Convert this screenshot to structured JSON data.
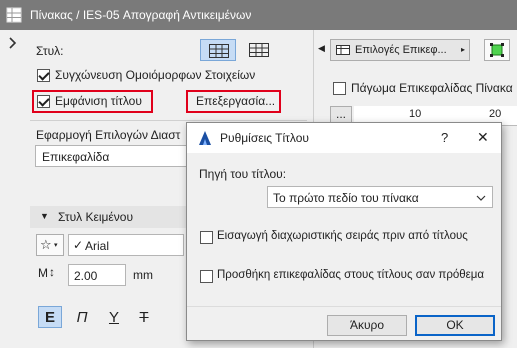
{
  "window": {
    "title": "Πίνακας / IES-05 Απογραφή Αντικειμένων"
  },
  "left": {
    "style_label": "Στυλ:",
    "merge_label": "Συγχώνευση Ομοιόμορφων Στοιχείων",
    "merge_checked": true,
    "show_title_label": "Εμφάνιση τίτλου",
    "show_title_checked": true,
    "edit_button": "Επεξεργασία...",
    "apply_options_label": "Εφαρμογή Επιλογών Διαστ",
    "apply_select_value": "Επικεφαλίδα",
    "text_style_section": "Στυλ Κειμένου",
    "font_value": "Arial",
    "size_value": "2.00",
    "size_unit": "mm",
    "format_buttons": [
      "E",
      "Π",
      "Y",
      "T"
    ]
  },
  "right": {
    "options_button": "Επιλογές Επικεφ...",
    "freeze_header_label": "Πάγωμα Επικεφαλίδας Πίνακα",
    "freeze_checked": false,
    "ruler_button": "...",
    "ruler_ticks": [
      "10",
      "20"
    ]
  },
  "dialog": {
    "title": "Ρυθμίσεις Τίτλου",
    "help": "?",
    "close": "✕",
    "source_label": "Πηγή του τίτλου:",
    "source_value": "Το πρώτο πεδίο του πίνακα",
    "insert_separator_label": "Εισαγωγή διαχωριστικής σειράς πριν από τίτλους",
    "insert_separator_checked": false,
    "add_header_prefix_label": "Προσθήκη επικεφαλίδας στους τίτλους σαν πρόθεμα",
    "add_header_prefix_checked": false,
    "cancel_button": "Άκυρο",
    "ok_button": "OK"
  },
  "colors": {
    "titlebar": "#7a7a7a",
    "highlight_red": "#e0001b",
    "accent_blue": "#0a64c8"
  }
}
